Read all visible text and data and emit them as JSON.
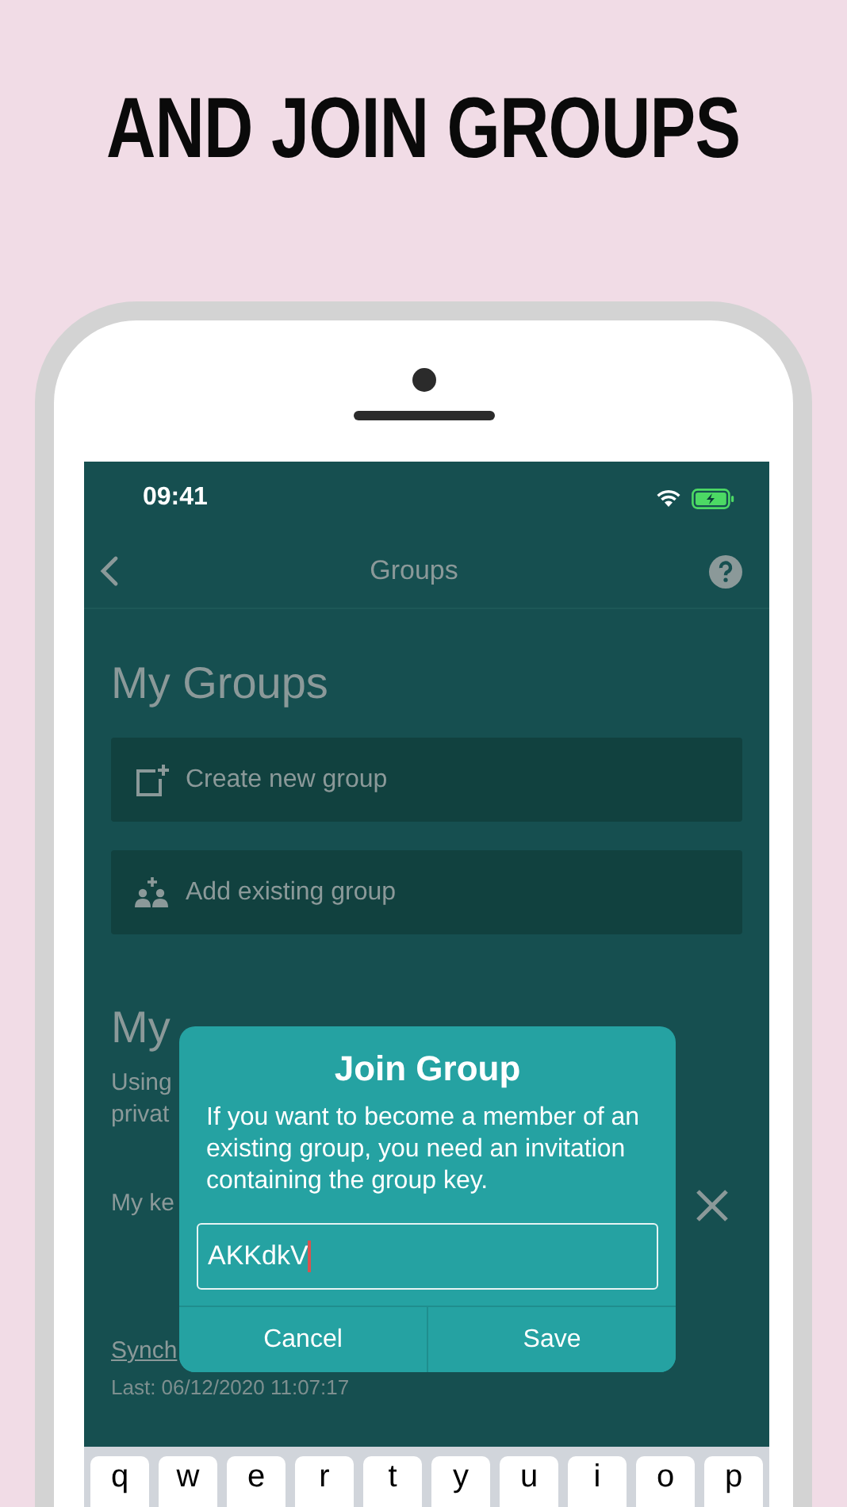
{
  "headline": "AND JOIN GROUPS",
  "status_bar": {
    "time": "09:41"
  },
  "nav": {
    "title": "Groups"
  },
  "my_groups": {
    "heading": "My Groups",
    "actions": [
      {
        "label": "Create new group",
        "kind": "create"
      },
      {
        "label": "Add existing group",
        "kind": "add"
      }
    ]
  },
  "cloud": {
    "heading": "My",
    "lines": [
      "Using",
      "privat"
    ],
    "key_label": "My ke",
    "sync_link": "Synch",
    "last_sync": "Last: 06/12/2020 11:07:17"
  },
  "dialog": {
    "title": "Join Group",
    "message": "If you want to become a member of an existing group, you need an invitation containing the group key.",
    "input_value": "AKKdkV",
    "buttons": [
      "Cancel",
      "Save"
    ]
  },
  "keyboard": {
    "keys": [
      "q",
      "w",
      "e",
      "r",
      "t",
      "y",
      "u",
      "i",
      "o",
      "p"
    ]
  }
}
